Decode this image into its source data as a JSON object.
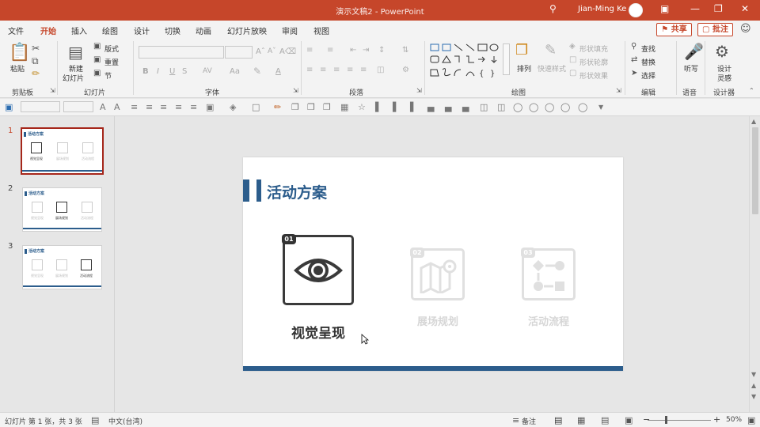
{
  "titlebar": {
    "doc_title": "演示文稿2  -  PowerPoint",
    "user_name": "Jian-Ming Ke",
    "search_icon": "search-icon",
    "window_controls": [
      "minimize-icon",
      "restore-icon",
      "close-icon"
    ]
  },
  "menu": {
    "tabs": [
      "文件",
      "开始",
      "插入",
      "绘图",
      "设计",
      "切换",
      "动画",
      "幻灯片放映",
      "审阅",
      "视图"
    ],
    "active_tab": "开始",
    "share_label": "共享",
    "comment_label": "批注"
  },
  "ribbon": {
    "groups": {
      "clipboard": "剪贴板",
      "slides": "幻灯片",
      "font": "字体",
      "paragraph": "段落",
      "drawing": "绘图",
      "editing": "编辑",
      "voice": "语音",
      "designer": "设计器"
    },
    "clipboard": {
      "paste": "粘贴"
    },
    "slides": {
      "new_slide_1": "新建",
      "new_slide_2": "幻灯片",
      "layout": "版式",
      "reset": "重置",
      "section": "节"
    },
    "font": {
      "bold": "B",
      "italic": "I",
      "underline": "U",
      "strike": "S",
      "spacing": "AV",
      "case": "Aa",
      "color": "A"
    },
    "drawing": {
      "arrange": "排列",
      "quick_styles": "快速样式",
      "shape_fill": "形状填充",
      "shape_outline": "形状轮廓",
      "shape_effects": "形状效果"
    },
    "editing": {
      "find": "查找",
      "replace": "替换",
      "select": "选择"
    },
    "voice": {
      "dictate": "听写"
    },
    "designer": {
      "design_ideas_1": "设计",
      "design_ideas_2": "灵感"
    }
  },
  "thumbnails": [
    {
      "num": "1",
      "title": "活动方案",
      "labels": [
        "视觉呈现",
        "展场规划",
        "活动流程"
      ],
      "active_index": 0
    },
    {
      "num": "2",
      "title": "活动方案",
      "labels": [
        "视觉呈现",
        "展场规划",
        "活动流程"
      ],
      "active_index": 1
    },
    {
      "num": "3",
      "title": "活动方案",
      "labels": [
        "视觉呈现",
        "展场规划",
        "活动流程"
      ],
      "active_index": 2
    }
  ],
  "slide": {
    "title": "活动方案",
    "cards": [
      {
        "badge": "01",
        "label": "视觉呈现",
        "icon": "eye-icon",
        "state": "active"
      },
      {
        "badge": "02",
        "label": "展场规划",
        "icon": "map-icon",
        "state": "dim"
      },
      {
        "badge": "03",
        "label": "活动流程",
        "icon": "flowchart-icon",
        "state": "dim"
      }
    ]
  },
  "status": {
    "slide_info": "幻灯片 第 1 张，共 3 张",
    "language": "中文(台湾)",
    "notes": "备注",
    "zoom": "50%"
  },
  "colors": {
    "accent_red": "#c6462a",
    "slide_blue": "#2c5d8c",
    "active_border": "#a5261a"
  }
}
